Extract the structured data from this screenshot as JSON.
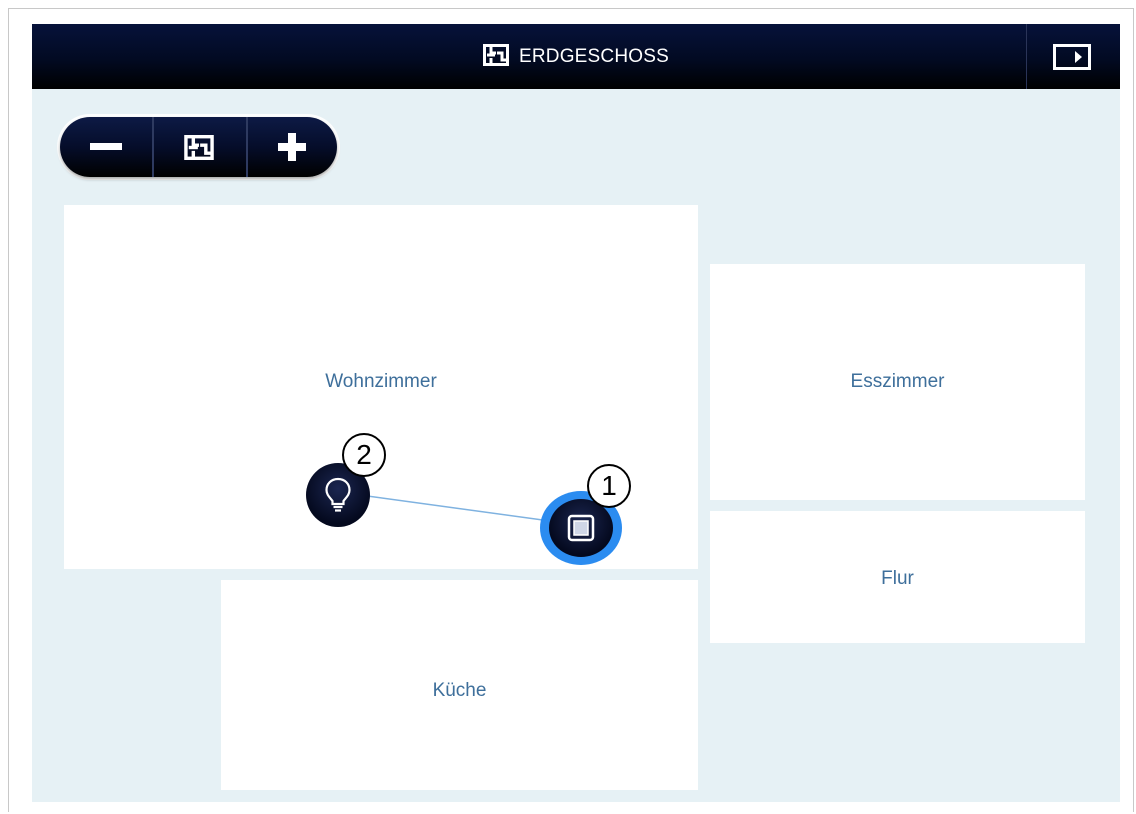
{
  "header": {
    "title": "ERDGESCHOSS",
    "title_icon": "floor-plan-icon",
    "panel_toggle_icon": "panel-toggle-icon"
  },
  "zoom_controls": {
    "zoom_out_icon": "minus-icon",
    "fit_icon": "floor-plan-icon",
    "zoom_in_icon": "plus-icon"
  },
  "rooms": [
    {
      "name": "Wohnzimmer"
    },
    {
      "name": "Esszimmer"
    },
    {
      "name": "Flur"
    },
    {
      "name": "Küche"
    }
  ],
  "devices": [
    {
      "number": "1",
      "type": "switch",
      "icon": "switch-icon",
      "selected": true,
      "room": "Wohnzimmer"
    },
    {
      "number": "2",
      "type": "light",
      "icon": "light-bulb-icon",
      "selected": false,
      "room": "Wohnzimmer"
    }
  ],
  "colors": {
    "header_bg": "#020a22",
    "canvas_bg": "#e6f1f5",
    "room_label": "#3e6f9b",
    "selection_ring": "#2b8cf0",
    "connector": "#7fb2e0"
  }
}
